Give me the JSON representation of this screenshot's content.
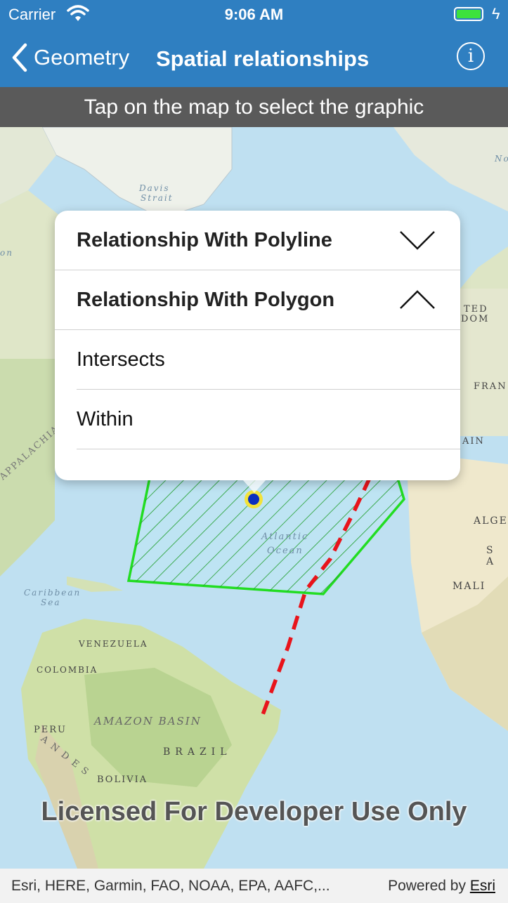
{
  "status_bar": {
    "carrier": "Carrier",
    "time": "9:06 AM",
    "battery_level": 1.0,
    "battery_color": "#3de23d",
    "wifi_icon": "wifi-icon",
    "charging_icon": "bolt-icon"
  },
  "nav": {
    "back_label": "Geometry",
    "title": "Spatial relationships",
    "info_icon": "i",
    "bar_color": "#2f7fc1"
  },
  "banner": {
    "text": "Tap on the map to select the graphic"
  },
  "panel": {
    "sections": [
      {
        "label": "Relationship With Polyline",
        "expanded": false
      },
      {
        "label": "Relationship With Polygon",
        "expanded": true
      }
    ],
    "polygon_relationships": [
      "Intersects",
      "Within"
    ]
  },
  "map": {
    "labels": {
      "davis_strait_1": "Davis",
      "davis_strait_2": "Strait",
      "appalachian": "APPALACHIAN",
      "caribbean_1": "Caribbean",
      "caribbean_2": "Sea",
      "atlantic_1": "Atlantic",
      "atlantic_2": "Ocean",
      "venezuela": "VENEZUELA",
      "colombia": "COLOMBIA",
      "amazon": "AMAZON BASIN",
      "peru": "PERU",
      "brazil": "BRAZIL",
      "bolivia": "BOLIVIA",
      "andes": "ANDES",
      "algeria": "ALGER",
      "mali": "MALI",
      "s_edge": "S A",
      "uk_1": "TED",
      "uk_2": "DOM",
      "france": "FRAN",
      "spain": "AIN",
      "no_edge": "No",
      "on_edge": "on"
    },
    "polygon_color": "#22dd22",
    "polyline_color": "#e8141b",
    "point_color": "#0b2fbf",
    "watermark": "Licensed For Developer Use Only"
  },
  "attribution": {
    "text": "Esri, HERE, Garmin, FAO, NOAA, EPA, AAFC,...",
    "powered_prefix": "Powered by",
    "powered_link": "Esri"
  }
}
